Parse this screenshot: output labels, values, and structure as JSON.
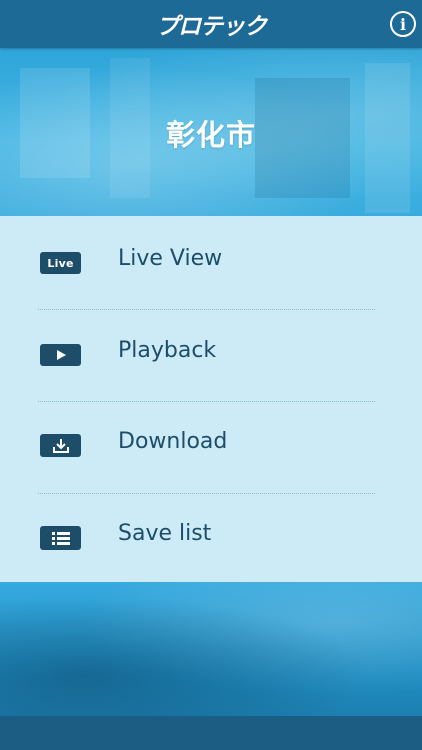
{
  "header": {
    "logo_text": "プロテック",
    "info_label": "i"
  },
  "hero": {
    "city_name": "彰化市"
  },
  "menu": {
    "items": [
      {
        "label": "Live View",
        "icon": "live-icon",
        "icon_text": "Live"
      },
      {
        "label": "Playback",
        "icon": "play-icon"
      },
      {
        "label": "Download",
        "icon": "download-icon"
      },
      {
        "label": "Save list",
        "icon": "list-icon"
      }
    ]
  },
  "colors": {
    "header_bg": "#1d6a97",
    "menu_bg": "#cdebf7",
    "menu_text": "#1d4d68",
    "icon_bg": "#1d4d68",
    "hero_accent": "#3ab0e0"
  }
}
